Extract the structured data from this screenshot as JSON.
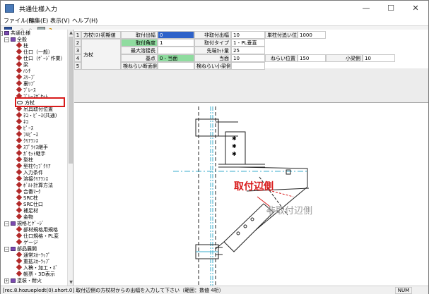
{
  "window": {
    "title": "共通仕様入力",
    "minimize": "—",
    "maximize": "☐",
    "close": "✕"
  },
  "menu": [
    "ファイル(F)",
    "編集(E)",
    "表示(V)",
    "ヘルプ(H)"
  ],
  "toolbar": {
    "icons": [
      "save-icon",
      "undo-icon",
      "redo-icon",
      "print-icon",
      "help-icon"
    ]
  },
  "tree": {
    "items": [
      {
        "label": "共通仕様",
        "kind": "folder",
        "toggle": "−"
      },
      {
        "label": "全般",
        "kind": "folder",
        "toggle": "−"
      },
      {
        "label": "柱",
        "kind": "item"
      },
      {
        "label": "仕口（一般）",
        "kind": "item"
      },
      {
        "label": "仕口（ｹﾞｰｼﾞ作業）",
        "kind": "item"
      },
      {
        "label": "梁",
        "kind": "item"
      },
      {
        "label": "ﾊﾝﾁ",
        "kind": "item"
      },
      {
        "label": "ｽﾘｰﾌﾞ",
        "kind": "item"
      },
      {
        "label": "裏ﾘﾌﾞ",
        "kind": "item"
      },
      {
        "label": "ﾌﾞﾚｰｽ",
        "kind": "item"
      },
      {
        "label": "ﾌﾞﾚｰｽｶﾞｾｯﾄ",
        "kind": "item"
      },
      {
        "label": "方杖",
        "kind": "wire"
      },
      {
        "label": "吊具取付位置",
        "kind": "item"
      },
      {
        "label": "ﾈｺ・ﾋﾟｰｽ(共通)",
        "kind": "item"
      },
      {
        "label": "ﾈｺ",
        "kind": "item"
      },
      {
        "label": "ﾋﾟｰｽ",
        "kind": "item"
      },
      {
        "label": "ﾌﾙﾋﾟｰｽ",
        "kind": "item"
      },
      {
        "label": "ｸﾘｱﾗﾝｽ",
        "kind": "item"
      },
      {
        "label": "ｽﾌﾟﾗｲｽ継手",
        "kind": "item"
      },
      {
        "label": "ｶﾞｾｯﾄ継手",
        "kind": "item"
      },
      {
        "label": "型柱",
        "kind": "item"
      },
      {
        "label": "型柱ｳｪﾌﾞｸﾘｱ",
        "kind": "item"
      },
      {
        "label": "入力条件",
        "kind": "item"
      },
      {
        "label": "溶接ｸﾘｱﾗﾝｽ",
        "kind": "item"
      },
      {
        "label": "ﾎﾞﾙﾄ計算方法",
        "kind": "item"
      },
      {
        "label": "合番ﾏｰｸ",
        "kind": "item"
      },
      {
        "label": "SRC柱",
        "kind": "item"
      },
      {
        "label": "SRC仕口",
        "kind": "item"
      },
      {
        "label": "補足材",
        "kind": "item"
      },
      {
        "label": "金物",
        "kind": "item"
      },
      {
        "label": "規格とｹﾞｰｼﾞ",
        "kind": "folder",
        "toggle": "−"
      },
      {
        "label": "部材規格用規格",
        "kind": "item"
      },
      {
        "label": "仕口規格・PL変",
        "kind": "item"
      },
      {
        "label": "ゲージ",
        "kind": "item"
      },
      {
        "label": "部品展開",
        "kind": "folder",
        "toggle": "−"
      },
      {
        "label": "通常ｽｶｰﾗｯﾌﾟ",
        "kind": "item"
      },
      {
        "label": "重拡ｽｶｰﾗｯﾌﾟ",
        "kind": "item"
      },
      {
        "label": "入稿・加工・ﾎﾞ",
        "kind": "item"
      },
      {
        "label": "帳票・3D表示",
        "kind": "item"
      },
      {
        "label": "塗装・耐火",
        "kind": "folder",
        "toggle": "+"
      }
    ],
    "selected": "方杖"
  },
  "grid": {
    "row_numbers": [
      "1",
      "2",
      "3",
      "4",
      "5"
    ],
    "cells": {
      "r1_label": "方杖ﾘｽﾄ初期値",
      "r1_mount_out_label": "取付出幅",
      "r1_mount_out_val": "0",
      "r1_nonmount_out_label": "非取付出幅",
      "r1_nonmount_out_val": "10",
      "r1_unit_pos_label": "単柱付追い位置",
      "r1_unit_pos_val": "1000",
      "r2_mount_angle_label": "取付角度",
      "r2_mount_angle_val": "1",
      "r2_mount_type_label": "取付タイプ",
      "r2_mount_type_val": "1 - PL垂直",
      "r_group_label": "方杖",
      "r3_min_weld_label": "最大溶接長",
      "r3_min_weld_val": "",
      "r3_tip_cut_label": "先端ｶｯﾄ量",
      "r3_tip_cut_val": "25",
      "r4_base_label": "基点",
      "r4_base_val": "0 - 当面",
      "r4_face_label": "当面",
      "r4_face_val": "10",
      "r4_aim_label": "ねらい位置",
      "r4_aim_val": "150",
      "r4_small_beam_label": "小梁側",
      "r4_small_beam_val": "10",
      "r5_aim_section_label": "検ねらい断面側",
      "r5_aim_section_val": "",
      "r5_aim_small_label": "検ねらい小梁側",
      "r5_aim_small_val": ""
    }
  },
  "drawing": {
    "label_mount_side": "取付辺側",
    "label_nonmount_side": "非取付辺側",
    "colors": {
      "mount": "#d81b1b",
      "nonmount": "#9a9a9a",
      "centerline": "#3aaecc"
    }
  },
  "status": {
    "text": "[rec.8.hozuepledt(0).short.0] 取付辺側の方杖材からの出幅を入力して下さい（範囲：数値 4桁）",
    "num": "NUM"
  }
}
